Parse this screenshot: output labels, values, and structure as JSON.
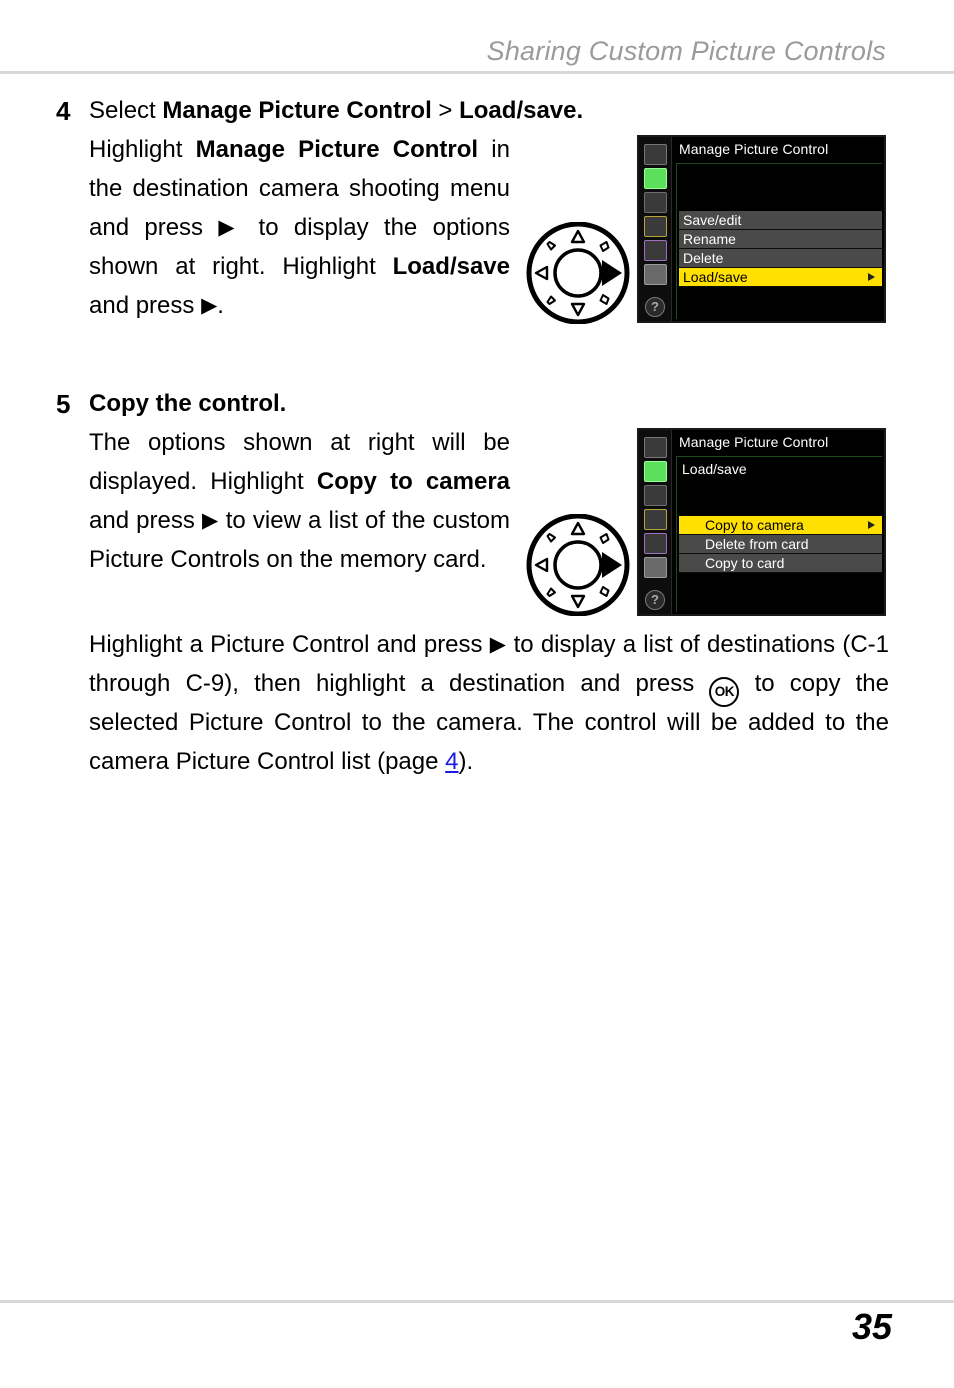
{
  "header": {
    "title": "Sharing Custom Picture Controls"
  },
  "steps": [
    {
      "number": "4",
      "title_lead": "Select ",
      "title_bold_1": "Manage Picture Control",
      "title_sep": " > ",
      "title_bold_2": "Load/save.",
      "body_lines": [
        "Highlight ",
        "Manage Picture Control",
        " in the destination camera shooting menu and press ",
        " to display the options shown at right. Highlight ",
        "Load/save",
        " and press ",
        "."
      ],
      "paragraph": "Highlight Manage Picture Control in the destination camera shooting menu and press ▶ to display the options shown at right. Highlight Load/save and press ▶."
    },
    {
      "number": "5",
      "title": "Copy the control.",
      "paragraph_narrow": "The options shown at right will be displayed. Highlight Copy to camera and press ▶ to view a list of the custom Picture Controls on the memory card.",
      "narrow_pre": "The options shown at right will be displayed. Highlight ",
      "narrow_bold": "Copy to camera",
      "narrow_post": " and press ",
      "narrow_tail": " to view a list of the custom Picture Controls on the memory card.",
      "wide_pre": "Highlight a Picture Control and press ",
      "wide_mid": " to display a list of destinations (C-1 through C-9), then highlight a destination and press ",
      "wide_post": " to copy the selected Picture Control to the camera. The control will be added to the camera Picture Control list (page ",
      "wide_link": "4",
      "wide_end": ")."
    }
  ],
  "glyphs": {
    "right_arrow": "▶",
    "ok_button": "OK",
    "help": "?"
  },
  "lcd_1": {
    "title": "Manage Picture Control",
    "subtitle": "",
    "rows": [
      {
        "label": "Save/edit",
        "selected": false,
        "arrow": false
      },
      {
        "label": "Rename",
        "selected": false,
        "arrow": false
      },
      {
        "label": "Delete",
        "selected": false,
        "arrow": false
      },
      {
        "label": "Load/save",
        "selected": true,
        "arrow": true
      }
    ],
    "sidebar_icons": [
      "playback-icon",
      "shooting-menu-icon",
      "custom-settings-icon",
      "setup-icon",
      "retouch-icon",
      "recent-settings-icon"
    ],
    "help_label": "?"
  },
  "lcd_2": {
    "title": "Manage Picture Control",
    "subtitle": "Load/save",
    "rows": [
      {
        "label": "Copy to camera",
        "selected": true,
        "arrow": true
      },
      {
        "label": "Delete from card",
        "selected": false,
        "arrow": false
      },
      {
        "label": "Copy to card",
        "selected": false,
        "arrow": false
      }
    ],
    "sidebar_icons": [
      "playback-icon",
      "shooting-menu-icon",
      "custom-settings-icon",
      "setup-icon",
      "retouch-icon",
      "recent-settings-icon"
    ],
    "help_label": "?"
  },
  "colors": {
    "highlight": "#ffe000",
    "menu_row": "#4a4a4a",
    "shooting_icon": "#5ce05c",
    "rule": "#d8d8d8",
    "header_text": "#9b9b9b",
    "link": "#1a1ae0"
  },
  "footer": {
    "page_number": "35"
  }
}
